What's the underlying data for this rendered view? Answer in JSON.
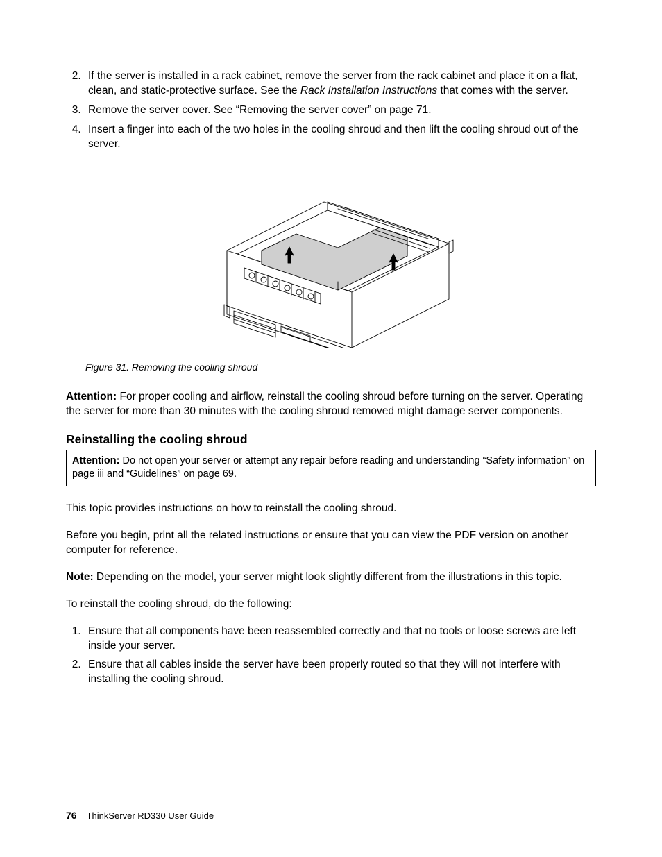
{
  "steps_top": {
    "start": 2,
    "item2_a": "If the server is installed in a rack cabinet, remove the server from the rack cabinet and place it on a flat, clean, and static-protective surface. See the ",
    "item2_em": "Rack Installation Instructions",
    "item2_b": " that comes with the server.",
    "item3": "Remove the server cover. See “Removing the server cover” on page 71.",
    "item4": "Insert a finger into each of the two holes in the cooling shroud and then lift the cooling shroud out of the server."
  },
  "figure": {
    "caption": "Figure 31.  Removing the cooling shroud"
  },
  "attention1": {
    "label": "Attention:",
    "text": " For proper cooling and airflow, reinstall the cooling shroud before turning on the server. Operating the server for more than 30 minutes with the cooling shroud removed might damage server components."
  },
  "section": {
    "heading": "Reinstalling the cooling shroud"
  },
  "attention_box": {
    "label": "Attention:",
    "text": " Do not open your server or attempt any repair before reading and understanding “Safety information” on page iii and “Guidelines” on page 69."
  },
  "para1": "This topic provides instructions on how to reinstall the cooling shroud.",
  "para2": "Before you begin, print all the related instructions or ensure that you can view the PDF version on another computer for reference.",
  "note": {
    "label": "Note:",
    "text": " Depending on the model, your server might look slightly different from the illustrations in this topic."
  },
  "para3": "To reinstall the cooling shroud, do the following:",
  "steps_bottom": {
    "item1": "Ensure that all components have been reassembled correctly and that no tools or loose screws are left inside your server.",
    "item2": "Ensure that all cables inside the server have been properly routed so that they will not interfere with installing the cooling shroud."
  },
  "footer": {
    "page": "76",
    "doc": "ThinkServer RD330 User Guide"
  }
}
